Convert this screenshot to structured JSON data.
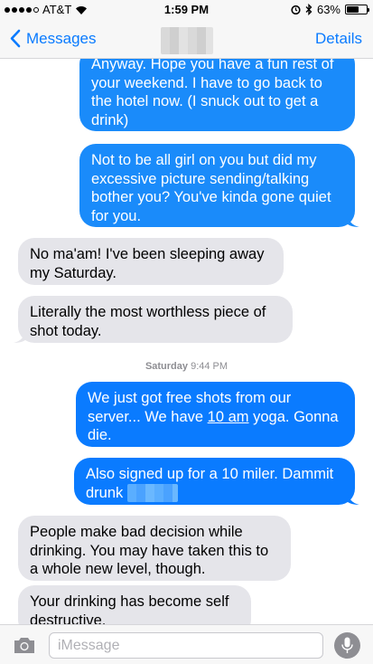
{
  "status_bar": {
    "carrier": "AT&T",
    "time": "1:59 PM",
    "battery_percent": "63%",
    "battery_level": 0.63
  },
  "nav": {
    "back_label": "Messages",
    "details_label": "Details"
  },
  "messages": [
    {
      "dir": "out",
      "text": "Anyway. Hope you have a fun rest of your weekend. I have to go back to the hotel now. (I snuck out to get a drink)"
    },
    {
      "dir": "out",
      "text": "Not to be all girl on you but did my excessive picture sending/talking bother you? You've kinda gone quiet for you."
    },
    {
      "dir": "in",
      "text": "No ma'am! I've been sleeping away my Saturday."
    },
    {
      "dir": "in",
      "text": "Literally the most worthless piece of shot today."
    },
    {
      "dir": "out",
      "text_before": "We just got free shots from our server... We have ",
      "link": "10 am",
      "text_after": " yoga. Gonna die."
    },
    {
      "dir": "out",
      "text": "Also signed up for a 10 miler. Dammit drunk"
    },
    {
      "dir": "in",
      "text": "People make bad decision while drinking. You may have taken this to a whole new level, though."
    },
    {
      "dir": "in",
      "text": "Your drinking has become self destructive."
    }
  ],
  "timestamp": {
    "day": "Saturday",
    "time": "9:44 PM"
  },
  "input": {
    "placeholder": "iMessage"
  },
  "icons": {
    "back": "chevron-left-icon",
    "camera": "camera-icon",
    "mic": "microphone-icon",
    "wifi": "wifi-icon",
    "bluetooth": "bluetooth-icon",
    "alarm": "alarm-icon"
  },
  "colors": {
    "accent": "#0a7bff",
    "outgoing_bubble": "#1a8bfa",
    "incoming_bubble": "#e5e5ea"
  }
}
